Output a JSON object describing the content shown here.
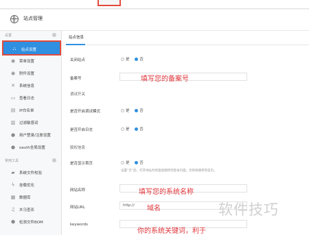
{
  "header": {
    "title": "站点管理"
  },
  "sidebar": {
    "section_settings": "设置",
    "items": [
      {
        "label": "站点设置",
        "icon": "sitemap-icon"
      },
      {
        "label": "菜单设置",
        "icon": "menu-icon"
      },
      {
        "label": "附件设置",
        "icon": "attachment-icon"
      },
      {
        "label": "系统信息",
        "icon": "tools-icon"
      },
      {
        "label": "查看日志",
        "icon": "log-icon"
      },
      {
        "label": "IP白名单",
        "icon": "whitelist-icon"
      },
      {
        "label": "过滤敏感词",
        "icon": "filter-icon"
      },
      {
        "label": "用户登录/注册设置",
        "icon": "user-icon"
      },
      {
        "label": "oauth全局设置",
        "icon": "oauth-icon"
      }
    ],
    "section_tools": "常用工具",
    "tools": [
      {
        "label": "系统文件校验",
        "icon": "folder-icon"
      },
      {
        "label": "挂载优化",
        "icon": "bolt-icon"
      },
      {
        "label": "数据库",
        "icon": "database-icon"
      },
      {
        "label": "木马查杀",
        "icon": "bell-icon"
      },
      {
        "label": "检测文件BOM",
        "icon": "shield-icon"
      }
    ]
  },
  "main": {
    "tab": "站点信息",
    "close_site_label": "关闭站点",
    "icp_label": "备案号",
    "icp_note": "填写您的备案号",
    "debug_section": "调试开关",
    "debug_mode_label": "是否开启调试模式",
    "log_label": "是否开启日志",
    "copyright_section": "版权信息",
    "show_home_label": "是否显示首页",
    "show_home_hint": "设置“否”后，打开地址时将直接跳转到登录页面，否则将跳转到首页。",
    "site_name_label": "网站名称",
    "site_name_note": "填写您的系统名称",
    "site_url_label": "网站URL",
    "site_url_value": "http://",
    "site_url_note": "域名",
    "keywords_label": "keywords",
    "keywords_note": "你的系统关键词，利于",
    "yes": "是",
    "no": "否"
  },
  "watermark": "软件技巧"
}
